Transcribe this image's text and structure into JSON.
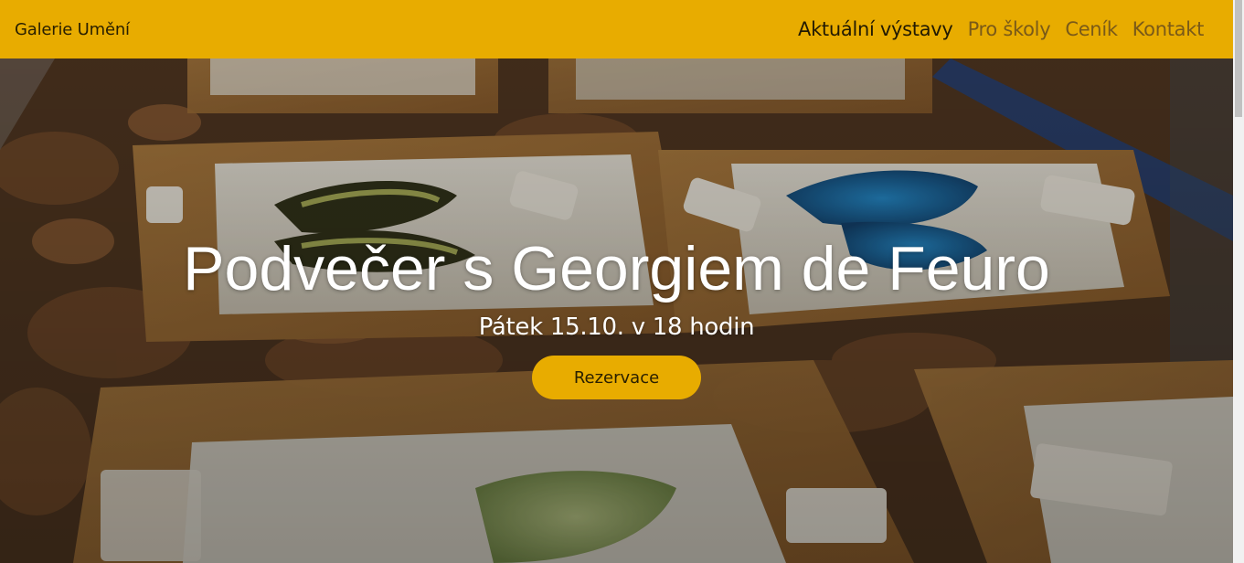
{
  "navbar": {
    "brand": "Galerie Umění",
    "links": [
      {
        "label": "Aktuální výstavy",
        "active": true
      },
      {
        "label": "Pro školy",
        "active": false
      },
      {
        "label": "Ceník",
        "active": false
      },
      {
        "label": "Kontakt",
        "active": false
      }
    ]
  },
  "hero": {
    "title": "Podvečer s Georgiem de Feuro",
    "subtitle": "Pátek 15.10. v 18 hodin",
    "cta_label": "Rezervace"
  },
  "colors": {
    "accent": "#e8ac00",
    "text_light": "#ffffff",
    "text_dark": "#2a2000"
  }
}
